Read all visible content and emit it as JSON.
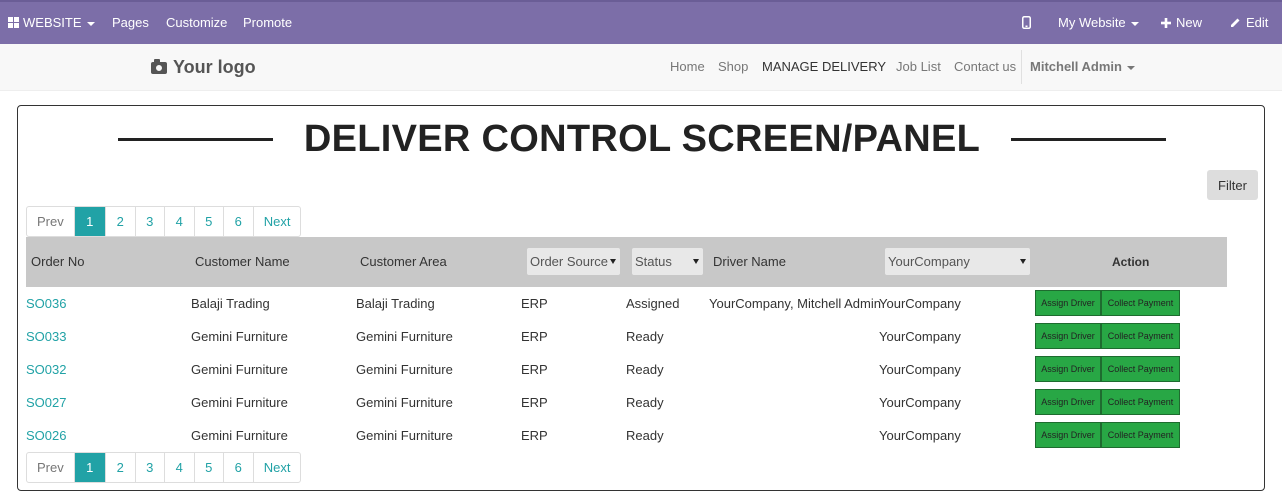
{
  "adminbar": {
    "website_label": "WEBSITE",
    "pages_label": "Pages",
    "customize_label": "Customize",
    "promote_label": "Promote",
    "mywebsite_label": "My Website",
    "new_label": "New",
    "edit_label": "Edit"
  },
  "header": {
    "logo_text": "Your logo",
    "nav": [
      "Home",
      "Shop",
      "MANAGE DELIVERY",
      "Job List",
      "Contact us"
    ],
    "active_nav": "MANAGE DELIVERY",
    "user_name": "Mitchell Admin"
  },
  "panel": {
    "title": "DELIVER CONTROL SCREEN/PANEL",
    "filter_label": "Filter"
  },
  "pagination": {
    "prev": "Prev",
    "pages": [
      "1",
      "2",
      "3",
      "4",
      "5",
      "6"
    ],
    "current": "1",
    "next": "Next"
  },
  "table": {
    "headers": {
      "order_no": "Order No",
      "customer_name": "Customer Name",
      "customer_area": "Customer Area",
      "order_source": "Order Source",
      "status": "Status",
      "driver_name": "Driver Name",
      "company": "YourCompany",
      "action": "Action"
    },
    "rows": [
      {
        "order": "SO036",
        "customer": "Balaji Trading",
        "area": "Balaji Trading",
        "source": "ERP",
        "status": "Assigned",
        "driver": "YourCompany, Mitchell Admin",
        "company": "YourCompany"
      },
      {
        "order": "SO033",
        "customer": "Gemini Furniture",
        "area": "Gemini Furniture",
        "source": "ERP",
        "status": "Ready",
        "driver": "",
        "company": "YourCompany"
      },
      {
        "order": "SO032",
        "customer": "Gemini Furniture",
        "area": "Gemini Furniture",
        "source": "ERP",
        "status": "Ready",
        "driver": "",
        "company": "YourCompany"
      },
      {
        "order": "SO027",
        "customer": "Gemini Furniture",
        "area": "Gemini Furniture",
        "source": "ERP",
        "status": "Ready",
        "driver": "",
        "company": "YourCompany"
      },
      {
        "order": "SO026",
        "customer": "Gemini Furniture",
        "area": "Gemini Furniture",
        "source": "ERP",
        "status": "Ready",
        "driver": "",
        "company": "YourCompany"
      }
    ],
    "assign_label": "Assign Driver",
    "collect_label": "Collect Payment"
  },
  "colors": {
    "adminbar": "#7c6ea8",
    "accent": "#21a2a6",
    "action_button": "#28a745"
  },
  "icons": {
    "website": "grid-icon",
    "mobile": "mobile-icon",
    "new": "plus-icon",
    "edit": "pencil-icon",
    "logo": "camera-icon"
  }
}
